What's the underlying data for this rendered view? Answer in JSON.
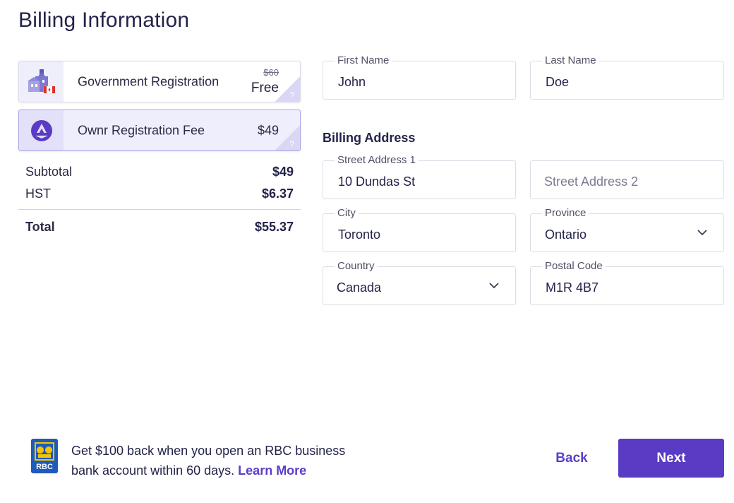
{
  "page": {
    "title": "Billing Information"
  },
  "order": {
    "items": [
      {
        "name": "Government Registration",
        "old_price": "$60",
        "price": "Free",
        "help": "?"
      },
      {
        "name": "Ownr Registration Fee",
        "price": "$49",
        "help": "?"
      }
    ],
    "subtotal": {
      "label": "Subtotal",
      "value": "$49"
    },
    "tax": {
      "label": "HST",
      "value": "$6.37"
    },
    "total": {
      "label": "Total",
      "value": "$55.37"
    }
  },
  "form": {
    "first_name": {
      "label": "First Name",
      "value": "John"
    },
    "last_name": {
      "label": "Last Name",
      "value": "Doe"
    },
    "billing_heading": "Billing Address",
    "street1": {
      "label": "Street Address 1",
      "value": "10 Dundas St"
    },
    "street2": {
      "placeholder": "Street Address 2"
    },
    "city": {
      "label": "City",
      "value": "Toronto"
    },
    "province": {
      "label": "Province",
      "value": "Ontario"
    },
    "country": {
      "label": "Country",
      "value": "Canada"
    },
    "postal": {
      "label": "Postal Code",
      "value": "M1R 4B7"
    }
  },
  "footer": {
    "promo_text": "Get $100 back when you open an RBC business bank account within 60 days.",
    "promo_link": "Learn More",
    "back_label": "Back",
    "next_label": "Next",
    "logo_text": "RBC"
  },
  "colors": {
    "accent": "#5a3cc4",
    "text": "#23234a",
    "selected_card": "#efeefd"
  },
  "icons": [
    "government-building-icon",
    "ownr-logo-icon",
    "chevron-down-icon",
    "rbc-logo",
    "help-icon"
  ]
}
